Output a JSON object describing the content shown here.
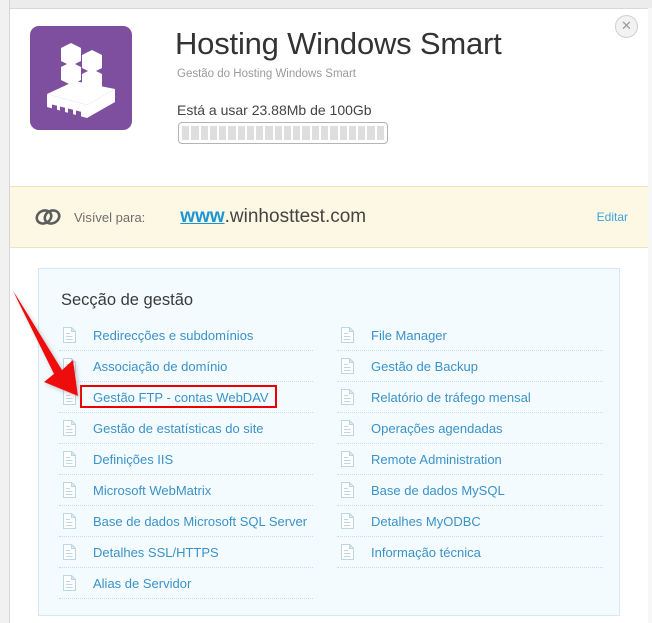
{
  "window": {
    "close_label": "✕"
  },
  "header": {
    "icon_name": "server-cubes-icon",
    "title": "Hosting Windows Smart",
    "subtitle": "Gestão do Hosting Windows Smart",
    "usage_text": "Está a usar 23.88Mb de 100Gb",
    "usage_used": "23.88Mb",
    "usage_total": "100Gb",
    "usage_percent": 0,
    "icon_bg_color": "#7e4f9e"
  },
  "visibility": {
    "icon_name": "chain-link-icon",
    "label": "Visível para:",
    "domain_prefix": "www",
    "domain_rest": ".winhosttest.com",
    "edit_label": "Editar",
    "banner_color": "#fdf8e3",
    "link_color": "#1b95d4"
  },
  "management": {
    "title": "Secção de gestão",
    "panel_color": "#f3fbfe",
    "link_color": "#3b92c9",
    "left_items": [
      {
        "label": "Redirecções e subdomínios",
        "icon": "document-icon"
      },
      {
        "label": "Associação de domínio",
        "icon": "document-icon"
      },
      {
        "label": "Gestão FTP - contas WebDAV",
        "icon": "document-icon"
      },
      {
        "label": "Gestão de estatísticas do site",
        "icon": "document-icon"
      },
      {
        "label": "Definições IIS",
        "icon": "document-icon"
      },
      {
        "label": "Microsoft WebMatrix",
        "icon": "document-icon"
      },
      {
        "label": "Base de dados Microsoft SQL Server",
        "icon": "document-icon"
      },
      {
        "label": "Detalhes SSL/HTTPS",
        "icon": "document-icon"
      },
      {
        "label": "Alias de Servidor",
        "icon": "document-icon"
      }
    ],
    "right_items": [
      {
        "label": "File Manager",
        "icon": "document-icon"
      },
      {
        "label": "Gestão de Backup",
        "icon": "document-icon"
      },
      {
        "label": "Relatório de tráfego mensal",
        "icon": "document-icon"
      },
      {
        "label": "Operações agendadas",
        "icon": "document-icon"
      },
      {
        "label": "Remote Administration",
        "icon": "document-icon"
      },
      {
        "label": "Base de dados MySQL",
        "icon": "document-icon"
      },
      {
        "label": "Detalhes MyODBC",
        "icon": "document-icon"
      },
      {
        "label": "Informação técnica",
        "icon": "document-icon"
      }
    ]
  },
  "annotation": {
    "highlight_target": "Gestão FTP - contas WebDAV",
    "color": "#ee0000",
    "arrow_name": "red-pointer-arrow"
  }
}
